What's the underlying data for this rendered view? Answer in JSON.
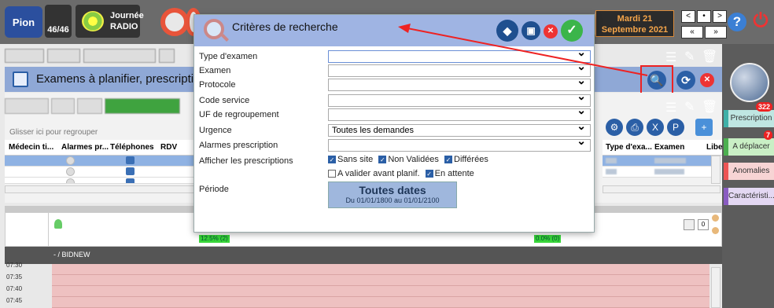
{
  "topbar": {
    "logo": "Pion",
    "counter": "46/46",
    "day_label": "Journée",
    "modality": "RADIO",
    "date_line1": "Mardi 21",
    "date_line2": "Septembre 2021",
    "nav_prev": "<",
    "nav_dot": "•",
    "nav_next": ">",
    "nav_first": "«",
    "nav_last": "»",
    "help": "?",
    "power": "⏻"
  },
  "banner": {
    "title": "Examens à planifier, prescriptio"
  },
  "grid": {
    "group_hint": "Glisser ici pour regrouper",
    "columns": [
      "Médecin ti...",
      "Alarmes pr...",
      "Téléphones",
      "RDV"
    ],
    "right_columns": [
      "Type d'exa...",
      "Examen",
      "Libe"
    ]
  },
  "side": {
    "prescription": "Prescription",
    "prescription_count": "322",
    "deplacer": "A déplacer",
    "deplacer_count": "7",
    "anomalies": "Anomalies",
    "caracteristiques": "Caractéristi..."
  },
  "schedule": {
    "pct1": "12.5% (2)",
    "pct2": "0.0% (0)",
    "bidnew": "- / BIDNEW",
    "times": [
      "07:30",
      "07:35",
      "07:40",
      "07:45"
    ],
    "counter": "0"
  },
  "modal": {
    "title": "Critères de recherche",
    "fields": [
      {
        "label": "Type d'examen",
        "value": ""
      },
      {
        "label": "Examen",
        "value": ""
      },
      {
        "label": "Protocole",
        "value": ""
      },
      {
        "label": "Code service",
        "value": ""
      },
      {
        "label": "UF de regroupement",
        "value": ""
      },
      {
        "label": "Urgence",
        "value": "Toutes les demandes"
      },
      {
        "label": "Alarmes prescription",
        "value": ""
      }
    ],
    "afficher_label": "Afficher les prescriptions",
    "cb_sans_site": "Sans site",
    "cb_non_validees": "Non Validées",
    "cb_differees": "Différées",
    "cb_a_valider": "A valider avant planif.",
    "cb_en_attente": "En attente",
    "periode_label": "Période",
    "period_main": "Toutes dates",
    "period_range": "Du 01/01/1800 au 01/01/2100"
  }
}
